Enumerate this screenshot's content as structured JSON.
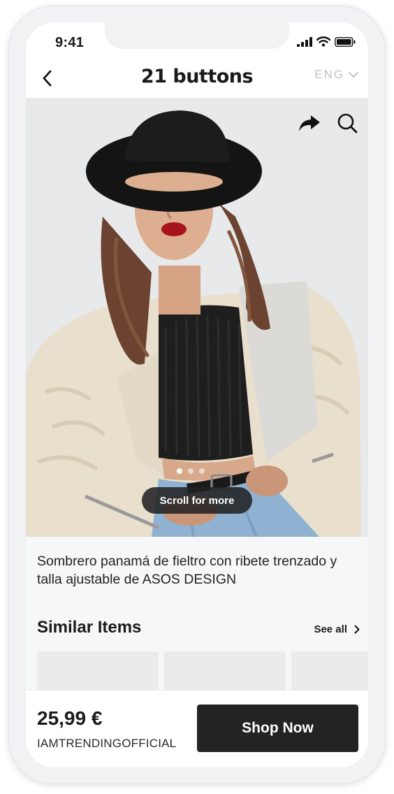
{
  "status_bar": {
    "time": "9:41"
  },
  "header": {
    "brand": "21 buttons",
    "language": "ENG"
  },
  "product": {
    "carousel_pages": 3,
    "carousel_active_index": 0,
    "scroll_hint": "Scroll for more",
    "description": "Sombrero panamá de fieltro con ribete trenzado y talla ajustable de ASOS DESIGN"
  },
  "similar": {
    "title": "Similar Items",
    "see_all_label": "See all",
    "cards": 3
  },
  "purchase": {
    "price": "25,99 €",
    "seller": "IAMTRENDINGOFFICIAL",
    "cta_label": "Shop Now"
  },
  "colors": {
    "accent": "#232323",
    "background": "#f6f7f9",
    "muted": "#bfc2c7"
  }
}
